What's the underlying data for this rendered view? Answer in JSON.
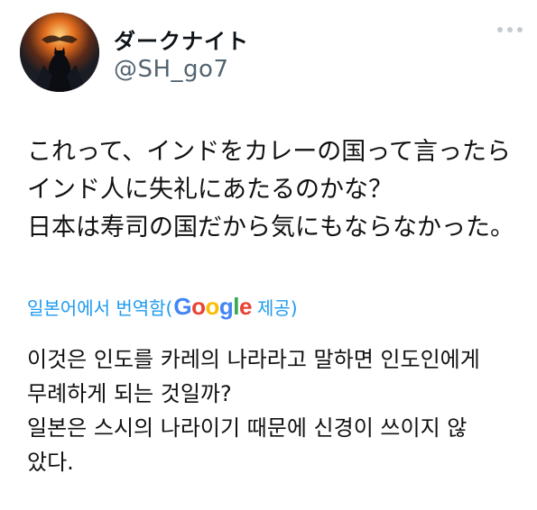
{
  "author": {
    "display_name": "ダークナイト",
    "handle": "@SH_go7",
    "avatar_icon": "batman-avatar-icon"
  },
  "more_icon": "more-dots-icon",
  "tweet": {
    "lines": [
      "これって、インドをカレーの国って言ったら",
      "インド人に失礼にあたるのかな？",
      "日本は寿司の国だから気にもならなかった。"
    ]
  },
  "translation": {
    "prefix": "일본어에서 번역함(",
    "logo": {
      "G": "G",
      "o1": "o",
      "o2": "o",
      "g": "g",
      "l": "l",
      "e": "e"
    },
    "suffix": " 제공)",
    "lines": [
      "이것은 인도를 카레의 나라라고 말하면 인도인에게",
      "무례하게 되는 것일까?",
      "일본은 스시의 나라이기 때문에 신경이 쓰이지 않",
      "았다."
    ]
  },
  "colors": {
    "link": "#1d9bf0",
    "handle": "#536471",
    "google_blue": "#4285f4",
    "google_red": "#ea4335",
    "google_yellow": "#fbbc05",
    "google_green": "#34a853"
  }
}
